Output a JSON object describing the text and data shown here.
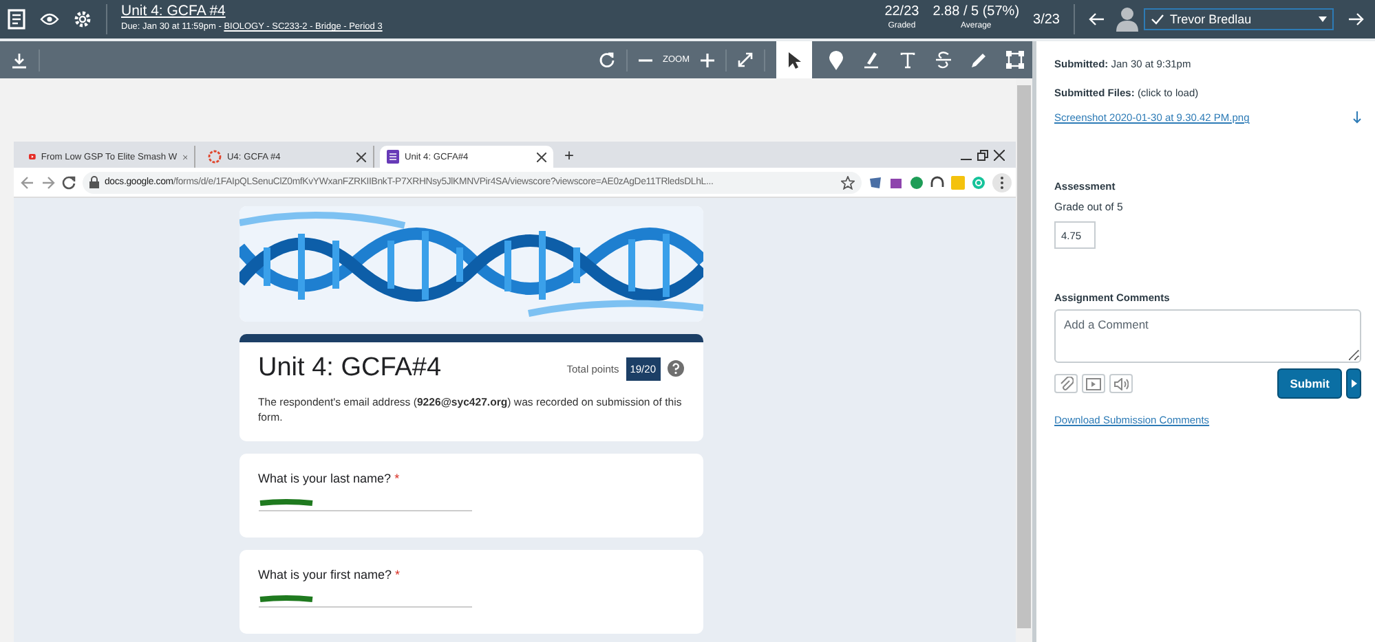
{
  "header": {
    "title": "Unit 4: GCFA #4",
    "due": "Due: Jan 30 at 11:59pm -",
    "course_link": "BIOLOGY - SC233-2 - Bridge - Period 3",
    "stats": [
      {
        "value": "22/23",
        "label": "Graded"
      },
      {
        "value": "2.88 / 5 (57%)",
        "label": "Average"
      }
    ],
    "position": "3/23",
    "student": {
      "name": "Trevor Bredlau",
      "submitted": true
    }
  },
  "toolbar": {
    "zoom_label": "ZOOM",
    "tools": [
      {
        "kind": "pointer",
        "selected": true
      },
      {
        "kind": "pin",
        "selected": false
      },
      {
        "kind": "highlight",
        "selected": false
      },
      {
        "kind": "text",
        "selected": false
      },
      {
        "kind": "strike",
        "selected": false
      },
      {
        "kind": "pen",
        "selected": false
      },
      {
        "kind": "area",
        "selected": false
      }
    ]
  },
  "browser": {
    "tabs": [
      {
        "title": "From Low GSP To Elite Smash W",
        "selected": false
      },
      {
        "title": "U4: GCFA #4",
        "selected": false
      },
      {
        "title": "Unit 4: GCFA#4",
        "selected": true
      }
    ],
    "new_tab": "+",
    "url_host": "docs.google.com",
    "url_path": "/forms/d/e/1FAIpQLSenuClZ0mfKvYWxanFZRKIIBnkT-P7XRHNsy5JlKMNVPir4SA/viewscore?viewscore=AE0zAgDe11TRledsDLhL...",
    "form": {
      "title": "Unit 4: GCFA#4",
      "total_points_label": "Total points",
      "score": "19/20",
      "email_note": "The respondent's email address (**9226@syc427.org**) was recorded on submission of this form.",
      "required_mark": "*",
      "questions": [
        {
          "text": "What is your last name?",
          "required": true
        },
        {
          "text": "What is your first name?",
          "required": true
        }
      ]
    }
  },
  "sidebar": {
    "submitted_label": "Submitted:",
    "submitted_value": "Jan 30 at 9:31pm",
    "files_label": "Submitted Files:",
    "files_hint": "(click to load)",
    "file": "Screenshot 2020-01-30 at 9.30.42 PM.png",
    "assessment_title": "Assessment",
    "grade_hint": "Grade out of 5",
    "grade": "4.75",
    "comments_title": "Assignment Comments",
    "comment_placeholder": "Add a Comment",
    "submit": "Submit",
    "download_link": "Download Submission Comments"
  }
}
